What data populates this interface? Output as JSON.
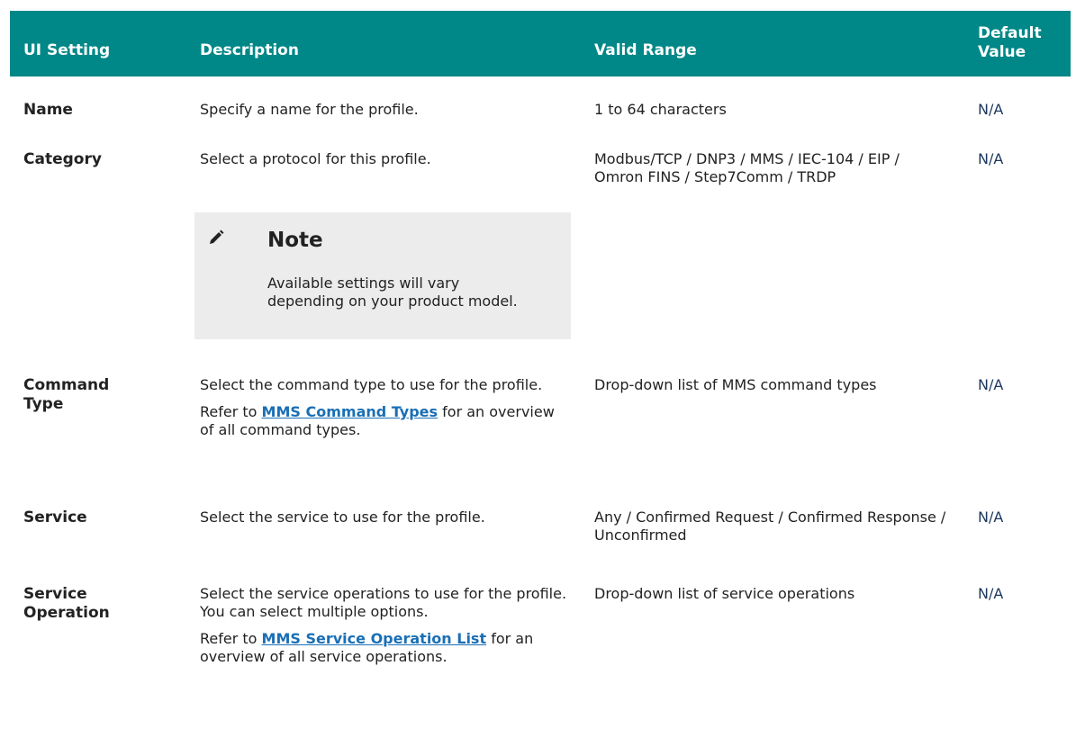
{
  "header": {
    "ui_setting": "UI Setting",
    "description": "Description",
    "valid_range": "Valid Range",
    "default_value_1": "Default",
    "default_value_2": "Value"
  },
  "rows": {
    "name": {
      "setting": "Name",
      "description": "Specify a name for the profile.",
      "range": "1 to 64 characters",
      "default": "N/A"
    },
    "category": {
      "setting": "Category",
      "description": "Select a protocol for this profile.",
      "range": "Modbus/TCP / DNP3 / MMS / IEC-104 / EIP / Omron FINS / Step7Comm / TRDP",
      "default": "N/A",
      "note": {
        "icon": "pencil-icon",
        "title": "Note",
        "body": "Available settings will vary depending on your product model."
      }
    },
    "command_type": {
      "setting_1": "Command",
      "setting_2": "Type",
      "description": "Select the command type to use for the profile.",
      "refer_prefix": "Refer to",
      "refer_link": "MMS Command Types",
      "refer_suffix": "for an overview of all command types.",
      "range": "Drop-down list of MMS command types",
      "default": "N/A"
    },
    "service": {
      "setting": "Service",
      "description": "Select the service to use for the profile.",
      "range": "Any / Confirmed Request / Confirmed Response / Unconfirmed",
      "default": "N/A"
    },
    "service_operation": {
      "setting_1": "Service",
      "setting_2": "Operation",
      "description": "Select the service operations to use for the profile. You can select multiple options.",
      "refer_prefix": "Refer to",
      "refer_link": "MMS Service Operation List",
      "refer_suffix": "for an overview of all service operations.",
      "range": "Drop-down list of service operations",
      "default": "N/A"
    }
  },
  "colors": {
    "header_bg": "#008787",
    "link": "#1a6fb5",
    "note_bg": "#ececec"
  }
}
